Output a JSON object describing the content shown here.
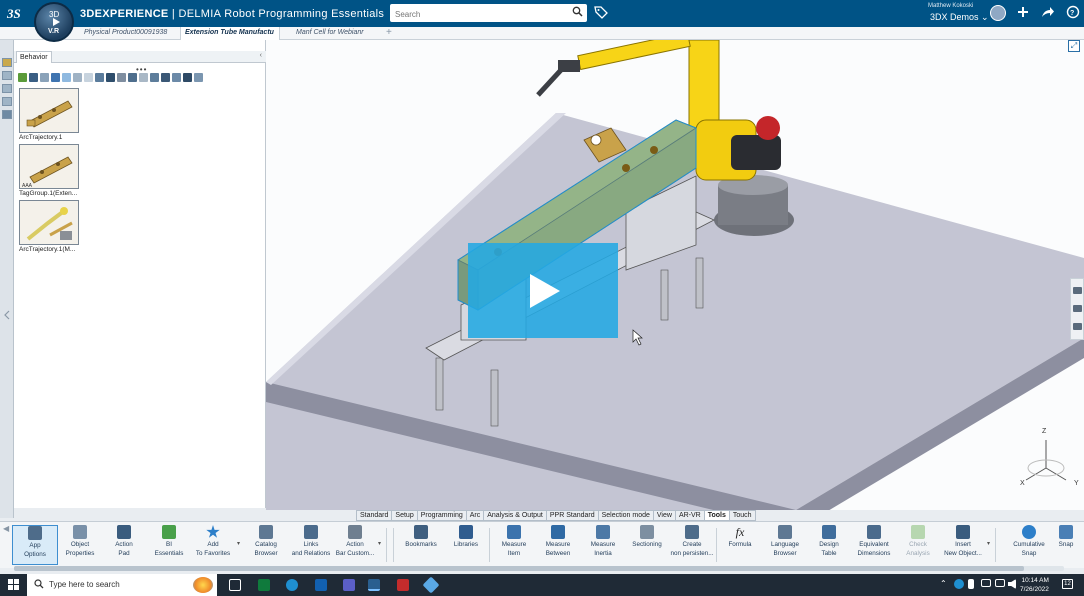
{
  "app": {
    "brand_bold": "3DEXPERIENCE",
    "brand_sep": " | DELMIA",
    "app_name": "Robot Programming Essentials",
    "compass_version": "V.R",
    "compass_top": "3D"
  },
  "search": {
    "placeholder": "Search",
    "icon": "search-icon"
  },
  "user": {
    "name": "Matthew Kokoski",
    "space": "3DX Demos ⌄"
  },
  "tabs": [
    {
      "label": "Physical Product00091938"
    },
    {
      "label": "Extension Tube Manufactu"
    },
    {
      "label": "Manf Cell for Webianr"
    }
  ],
  "tab_add": "+",
  "panel": {
    "tab_label": "Behavior",
    "minimize": "‹",
    "more": "•••",
    "items": [
      {
        "label": "ArcTrajectory.1"
      },
      {
        "label": "TagGroup.1(Exten..."
      },
      {
        "label": "ArcTrajectory.1(M..."
      }
    ]
  },
  "viewport": {
    "fit_icon": "⤢",
    "tripod": {
      "z": "Z",
      "x": "X",
      "y": "Y"
    },
    "colors": {
      "table_top": "#c6c8d6",
      "robot": "#f7d417",
      "tube": "#c4a02c",
      "highlight": "#40b4e8"
    }
  },
  "section_tabs": [
    "Standard",
    "Setup",
    "Programming",
    "Arc",
    "Analysis & Output",
    "PPR Standard",
    "Selection mode",
    "View",
    "AR-VR",
    "Tools",
    "Touch"
  ],
  "active_section": "Tools",
  "commands": [
    {
      "line1": "App",
      "line2": "Options"
    },
    {
      "line1": "Object",
      "line2": "Properties"
    },
    {
      "line1": "Action",
      "line2": "Pad"
    },
    {
      "line1": "BI",
      "line2": "Essentials"
    },
    {
      "line1": "Add",
      "line2": "To Favorites"
    },
    {
      "line1": "Catalog",
      "line2": "Browser"
    },
    {
      "line1": "Links",
      "line2": "and Relations"
    },
    {
      "line1": "Action",
      "line2": "Bar Custom..."
    },
    {
      "line1": "Bookmarks",
      "line2": ""
    },
    {
      "line1": "Libraries",
      "line2": ""
    },
    {
      "line1": "Measure",
      "line2": "Item"
    },
    {
      "line1": "Measure",
      "line2": "Between"
    },
    {
      "line1": "Measure",
      "line2": "Inertia"
    },
    {
      "line1": "Sectioning",
      "line2": ""
    },
    {
      "line1": "Create",
      "line2": "non persisten..."
    },
    {
      "line1": "Formula",
      "line2": ""
    },
    {
      "line1": "Language",
      "line2": "Browser"
    },
    {
      "line1": "Design",
      "line2": "Table"
    },
    {
      "line1": "Equivalent",
      "line2": "Dimensions"
    },
    {
      "line1": "Check",
      "line2": "Analysis"
    },
    {
      "line1": "Insert",
      "line2": "New Object..."
    },
    {
      "line1": "Cumulative",
      "line2": "Snap"
    },
    {
      "line1": "Snap",
      "line2": ""
    }
  ],
  "taskbar": {
    "search_text": "Type here to search",
    "time": "10:14 AM",
    "date": "7/26/2022",
    "notifications": "12"
  }
}
